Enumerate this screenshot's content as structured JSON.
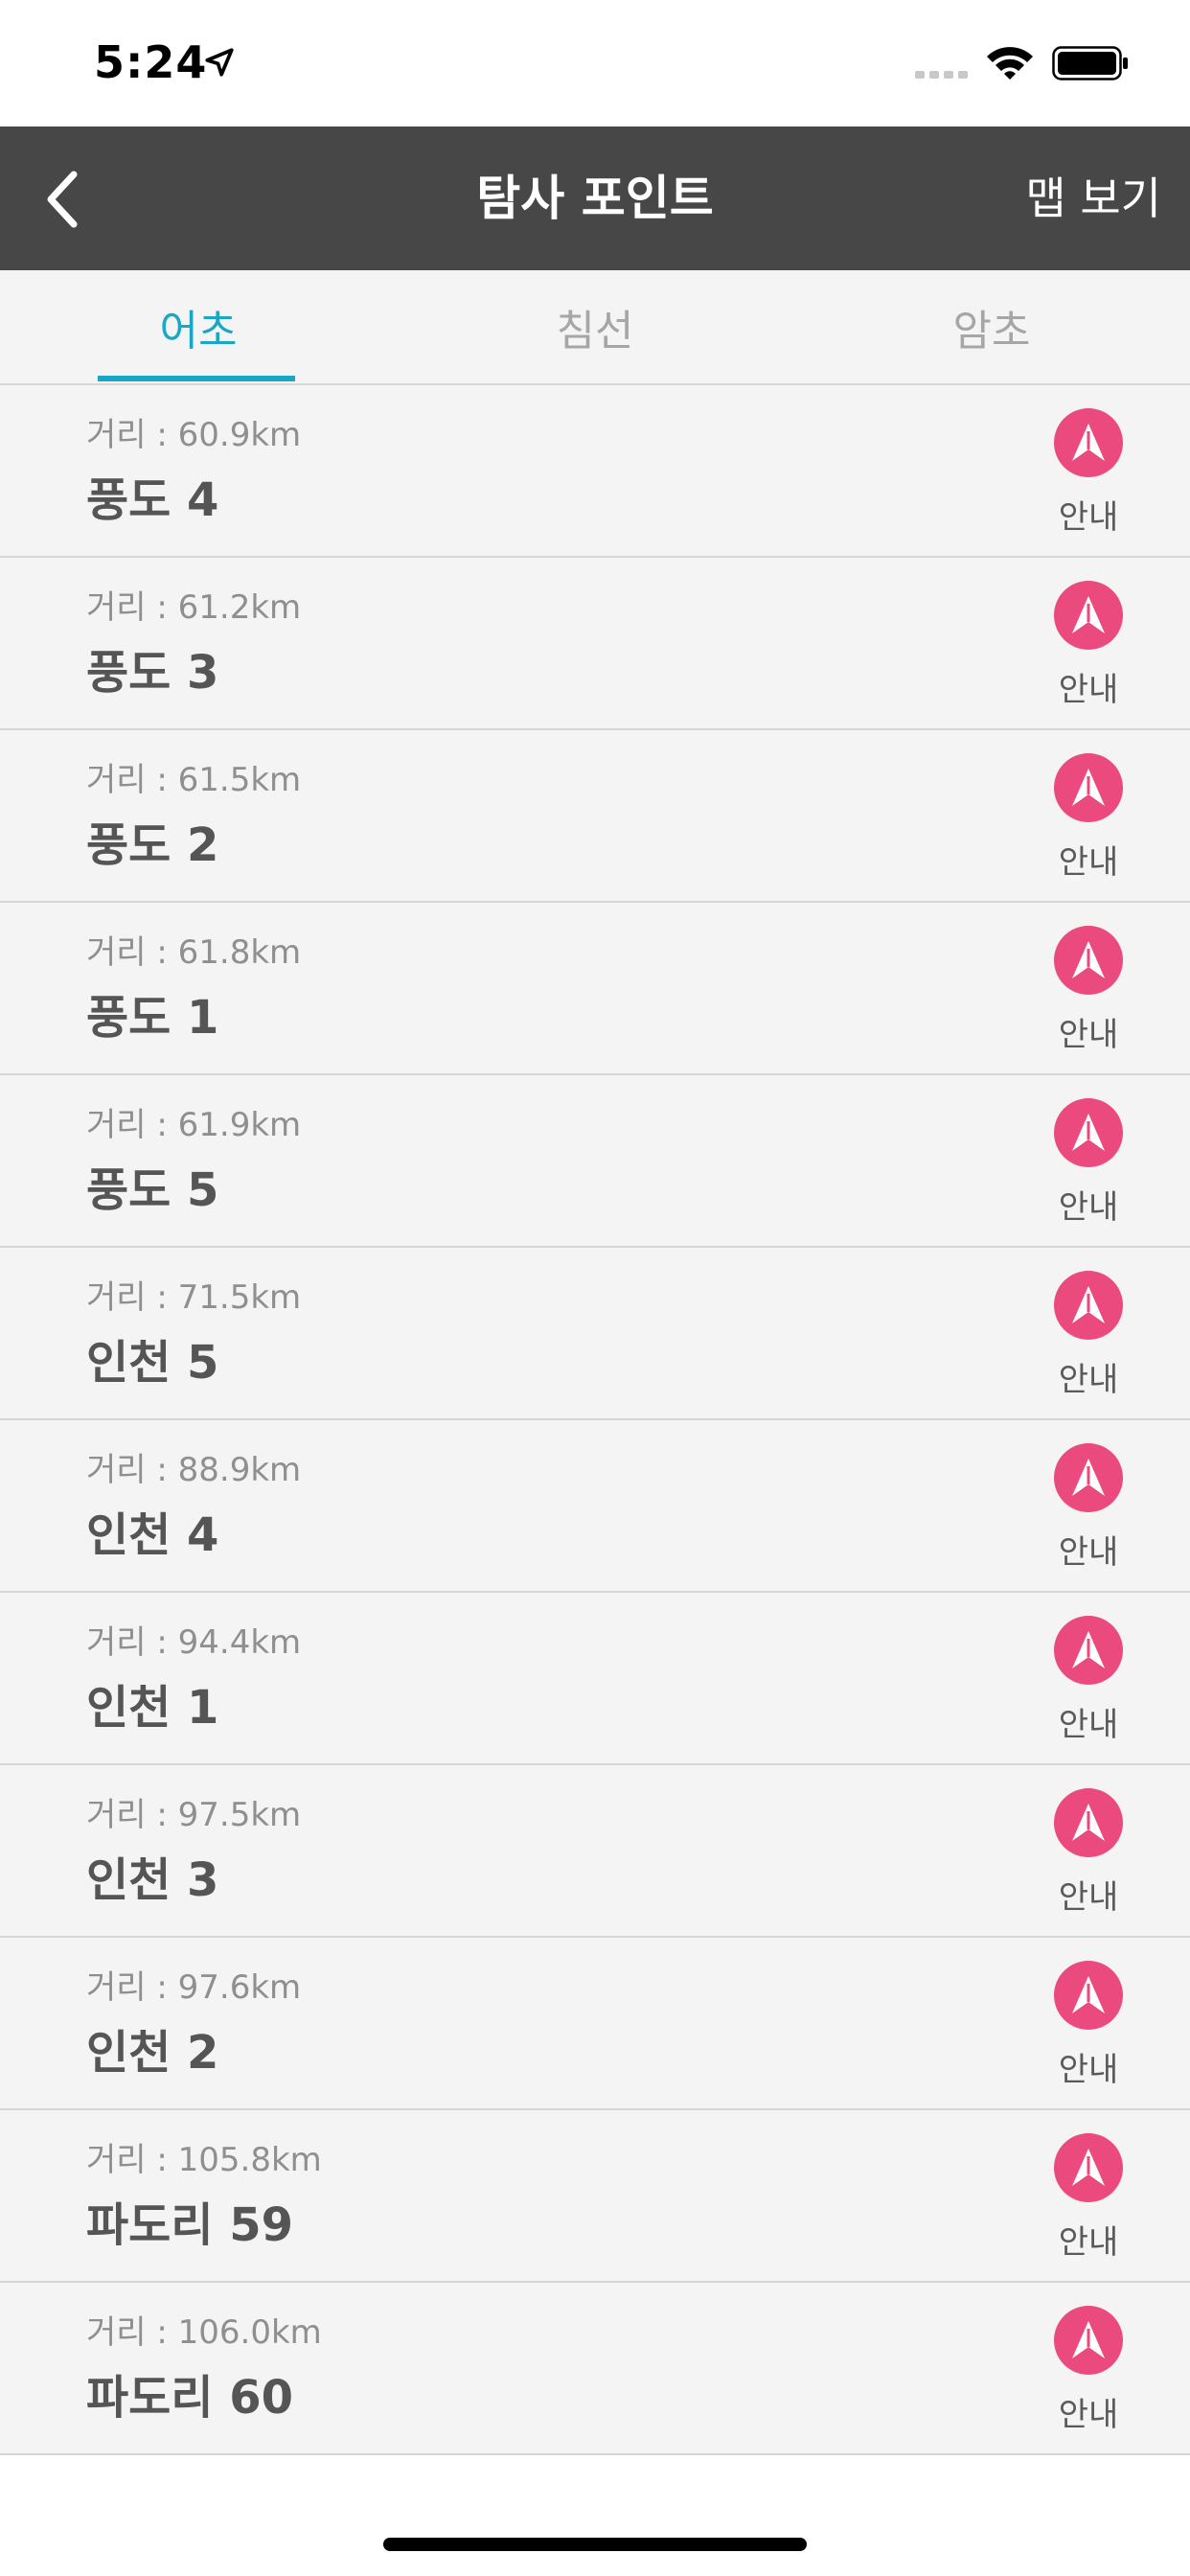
{
  "status_bar": {
    "time": "5:24"
  },
  "nav": {
    "title": "탐사 포인트",
    "map_label": "맵 보기"
  },
  "tabs": [
    {
      "label": "어초",
      "active": true
    },
    {
      "label": "침선",
      "active": false
    },
    {
      "label": "암초",
      "active": false
    }
  ],
  "rows": [
    {
      "distance": "거리 : 60.9km",
      "name": "풍도 4",
      "guide_label": "안내"
    },
    {
      "distance": "거리 : 61.2km",
      "name": "풍도 3",
      "guide_label": "안내"
    },
    {
      "distance": "거리 : 61.5km",
      "name": "풍도 2",
      "guide_label": "안내"
    },
    {
      "distance": "거리 : 61.8km",
      "name": "풍도 1",
      "guide_label": "안내"
    },
    {
      "distance": "거리 : 61.9km",
      "name": "풍도 5",
      "guide_label": "안내"
    },
    {
      "distance": "거리 : 71.5km",
      "name": "인천 5",
      "guide_label": "안내"
    },
    {
      "distance": "거리 : 88.9km",
      "name": "인천 4",
      "guide_label": "안내"
    },
    {
      "distance": "거리 : 94.4km",
      "name": "인천 1",
      "guide_label": "안내"
    },
    {
      "distance": "거리 : 97.5km",
      "name": "인천 3",
      "guide_label": "안내"
    },
    {
      "distance": "거리 : 97.6km",
      "name": "인천 2",
      "guide_label": "안내"
    },
    {
      "distance": "거리 : 105.8km",
      "name": "파도리 59",
      "guide_label": "안내"
    },
    {
      "distance": "거리 : 106.0km",
      "name": "파도리 60",
      "guide_label": "안내"
    }
  ],
  "colors": {
    "nav_bg": "#474747",
    "accent": "#1aa7c6",
    "guide": "#ea4a7e",
    "list_bg": "#f4f4f4"
  },
  "icons": {
    "back": "chevron-left-icon",
    "guide": "navigation-arrow-icon",
    "location": "location-arrow-icon"
  }
}
